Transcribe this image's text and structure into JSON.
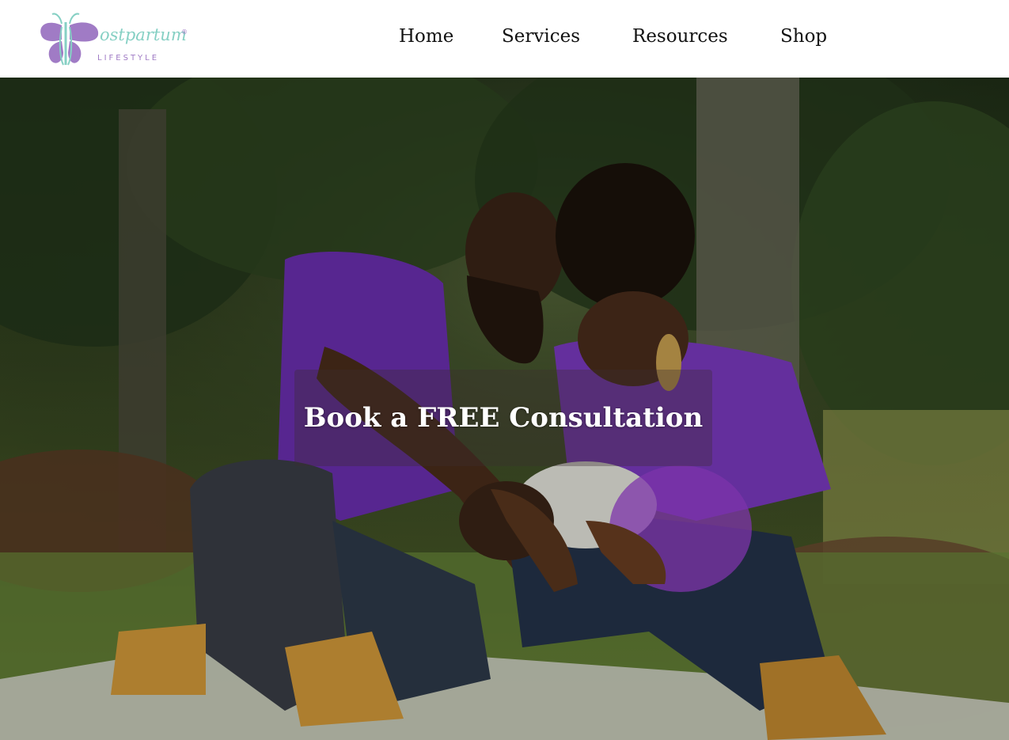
{
  "brand": {
    "logo_name": "ostpartum",
    "logo_sub": "LIFESTYLE",
    "logo_reg": "®",
    "colors": {
      "butterfly_purple": "#a07bc5",
      "butterfly_teal": "#86d0c4"
    }
  },
  "nav": {
    "items": [
      {
        "label": "Home"
      },
      {
        "label": "Services"
      },
      {
        "label": "Resources"
      },
      {
        "label": "Shop"
      }
    ]
  },
  "hero": {
    "image_icon": "family-photo",
    "cta_label": "Book a FREE Consultation"
  }
}
